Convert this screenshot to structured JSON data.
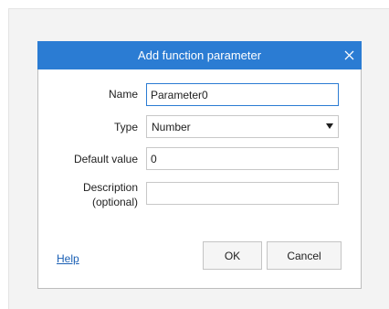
{
  "dialog": {
    "title": "Add function parameter",
    "close_icon": "close-icon"
  },
  "form": {
    "name": {
      "label": "Name",
      "value": "Parameter0"
    },
    "type": {
      "label": "Type",
      "selected": "Number",
      "icon": "dropdown-triangle-icon"
    },
    "default_value": {
      "label": "Default value",
      "value": "0"
    },
    "description": {
      "label_line1": "Description",
      "label_line2": "(optional)",
      "value": ""
    }
  },
  "footer": {
    "help_label": "Help",
    "ok_label": "OK",
    "cancel_label": "Cancel"
  },
  "colors": {
    "titlebar": "#2b7cd3",
    "link": "#1a5fb4",
    "focus_border": "#2b7cd3"
  }
}
